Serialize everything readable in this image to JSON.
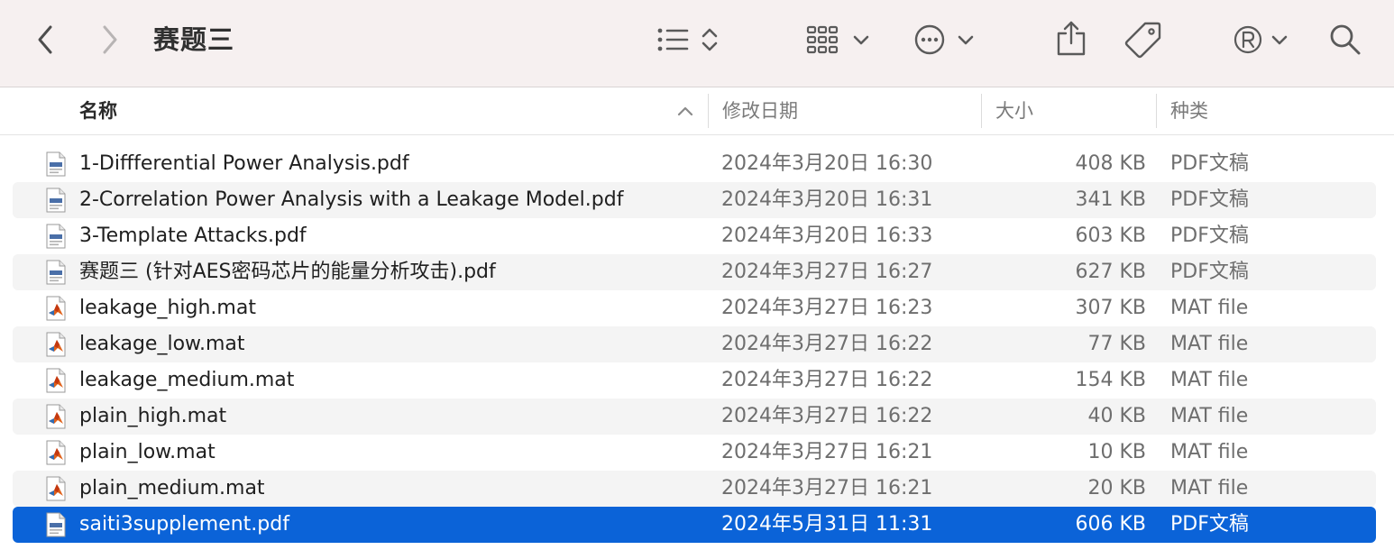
{
  "window": {
    "title": "赛题三"
  },
  "toolbar": {
    "back": "chevron-left-icon",
    "forward": "chevron-right-icon",
    "view_list": "list-icon",
    "group": "grid-icon",
    "action": "more-icon",
    "share": "share-icon",
    "tags": "tag-icon",
    "extension": "registered-icon",
    "search": "search-icon"
  },
  "columns": {
    "name": "名称",
    "date": "修改日期",
    "size": "大小",
    "kind": "种类"
  },
  "files": [
    {
      "name": "1-Diffferential Power Analysis.pdf",
      "date": "2024年3月20日 16:30",
      "size": "408 KB",
      "kind": "PDF文稿",
      "icon": "pdf-file-icon"
    },
    {
      "name": "2-Correlation Power Analysis  with a Leakage Model.pdf",
      "date": "2024年3月20日 16:31",
      "size": "341 KB",
      "kind": "PDF文稿",
      "icon": "pdf-file-icon"
    },
    {
      "name": "3-Template Attacks.pdf",
      "date": "2024年3月20日 16:33",
      "size": "603 KB",
      "kind": "PDF文稿",
      "icon": "pdf-file-icon"
    },
    {
      "name": "赛题三 (针对AES密码芯片的能量分析攻击).pdf",
      "date": "2024年3月27日 16:27",
      "size": "627 KB",
      "kind": "PDF文稿",
      "icon": "pdf-file-icon"
    },
    {
      "name": "leakage_high.mat",
      "date": "2024年3月27日 16:23",
      "size": "307 KB",
      "kind": "MAT file",
      "icon": "matlab-file-icon"
    },
    {
      "name": "leakage_low.mat",
      "date": "2024年3月27日 16:22",
      "size": "77 KB",
      "kind": "MAT file",
      "icon": "matlab-file-icon"
    },
    {
      "name": "leakage_medium.mat",
      "date": "2024年3月27日 16:22",
      "size": "154 KB",
      "kind": "MAT file",
      "icon": "matlab-file-icon"
    },
    {
      "name": "plain_high.mat",
      "date": "2024年3月27日 16:22",
      "size": "40 KB",
      "kind": "MAT file",
      "icon": "matlab-file-icon"
    },
    {
      "name": "plain_low.mat",
      "date": "2024年3月27日 16:21",
      "size": "10 KB",
      "kind": "MAT file",
      "icon": "matlab-file-icon"
    },
    {
      "name": "plain_medium.mat",
      "date": "2024年3月27日 16:21",
      "size": "20 KB",
      "kind": "MAT file",
      "icon": "matlab-file-icon"
    },
    {
      "name": "saiti3supplement.pdf",
      "date": "2024年5月31日 11:31",
      "size": "606 KB",
      "kind": "PDF文稿",
      "icon": "pdf-file-icon",
      "selected": true
    }
  ],
  "colors": {
    "selection": "#0b63d8",
    "toolbar_bg": "#f6f0f0",
    "alt_row": "#f4f4f4"
  }
}
